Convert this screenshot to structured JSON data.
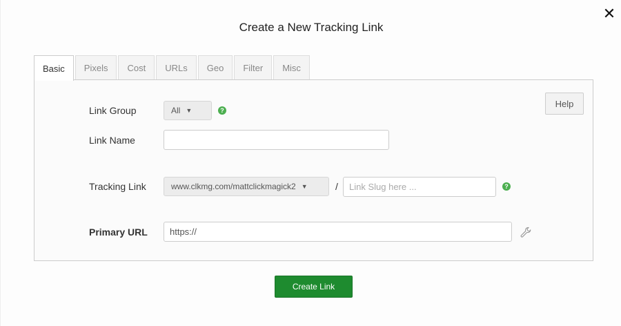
{
  "dialog": {
    "title": "Create a New Tracking Link",
    "close_label": "✕"
  },
  "tabs": [
    {
      "label": "Basic",
      "active": true
    },
    {
      "label": "Pixels"
    },
    {
      "label": "Cost"
    },
    {
      "label": "URLs"
    },
    {
      "label": "Geo"
    },
    {
      "label": "Filter"
    },
    {
      "label": "Misc"
    }
  ],
  "help_label": "Help",
  "form": {
    "link_group": {
      "label": "Link Group",
      "selected": "All"
    },
    "link_name": {
      "label": "Link Name",
      "value": ""
    },
    "tracking_link": {
      "label": "Tracking Link",
      "domain": "www.clkmg.com/mattclickmagick2",
      "separator": "/",
      "slug_placeholder": "Link Slug here ..."
    },
    "primary_url": {
      "label": "Primary URL",
      "value": "https://"
    }
  },
  "create_button_label": "Create Link",
  "colors": {
    "accent_green": "#1e8b2f",
    "help_icon_green": "#4caf50"
  }
}
